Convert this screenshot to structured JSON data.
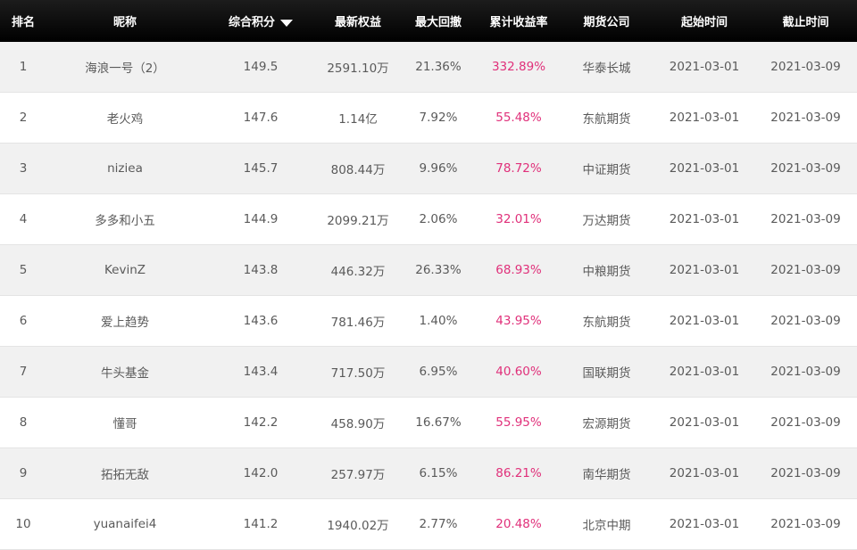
{
  "headers": {
    "rank": "排名",
    "nickname": "昵称",
    "score": "综合积分",
    "equity": "最新权益",
    "drawdown": "最大回撤",
    "return": "累计收益率",
    "company": "期货公司",
    "start": "起始时间",
    "end": "截止时间"
  },
  "colors": {
    "header_bg": "#000000",
    "return_text": "#e0307a",
    "row_alt_bg": "#f1f1f1"
  },
  "sort": {
    "column": "score",
    "direction": "desc",
    "icon": "sort-desc-icon"
  },
  "rows": [
    {
      "rank": "1",
      "nickname": "海浪一号（2）",
      "score": "149.5",
      "equity": "2591.10万",
      "drawdown": "21.36%",
      "return": "332.89%",
      "company": "华泰长城",
      "start": "2021-03-01",
      "end": "2021-03-09"
    },
    {
      "rank": "2",
      "nickname": "老火鸡",
      "score": "147.6",
      "equity": "1.14亿",
      "drawdown": "7.92%",
      "return": "55.48%",
      "company": "东航期货",
      "start": "2021-03-01",
      "end": "2021-03-09"
    },
    {
      "rank": "3",
      "nickname": "niziea",
      "score": "145.7",
      "equity": "808.44万",
      "drawdown": "9.96%",
      "return": "78.72%",
      "company": "中证期货",
      "start": "2021-03-01",
      "end": "2021-03-09"
    },
    {
      "rank": "4",
      "nickname": "多多和小五",
      "score": "144.9",
      "equity": "2099.21万",
      "drawdown": "2.06%",
      "return": "32.01%",
      "company": "万达期货",
      "start": "2021-03-01",
      "end": "2021-03-09"
    },
    {
      "rank": "5",
      "nickname": "KevinZ",
      "score": "143.8",
      "equity": "446.32万",
      "drawdown": "26.33%",
      "return": "68.93%",
      "company": "中粮期货",
      "start": "2021-03-01",
      "end": "2021-03-09"
    },
    {
      "rank": "6",
      "nickname": "爱上趋势",
      "score": "143.6",
      "equity": "781.46万",
      "drawdown": "1.40%",
      "return": "43.95%",
      "company": "东航期货",
      "start": "2021-03-01",
      "end": "2021-03-09"
    },
    {
      "rank": "7",
      "nickname": "牛头基金",
      "score": "143.4",
      "equity": "717.50万",
      "drawdown": "6.95%",
      "return": "40.60%",
      "company": "国联期货",
      "start": "2021-03-01",
      "end": "2021-03-09"
    },
    {
      "rank": "8",
      "nickname": "懂哥",
      "score": "142.2",
      "equity": "458.90万",
      "drawdown": "16.67%",
      "return": "55.95%",
      "company": "宏源期货",
      "start": "2021-03-01",
      "end": "2021-03-09"
    },
    {
      "rank": "9",
      "nickname": "拓拓无敌",
      "score": "142.0",
      "equity": "257.97万",
      "drawdown": "6.15%",
      "return": "86.21%",
      "company": "南华期货",
      "start": "2021-03-01",
      "end": "2021-03-09"
    },
    {
      "rank": "10",
      "nickname": "yuanaifei4",
      "score": "141.2",
      "equity": "1940.02万",
      "drawdown": "2.77%",
      "return": "20.48%",
      "company": "北京中期",
      "start": "2021-03-01",
      "end": "2021-03-09"
    }
  ]
}
